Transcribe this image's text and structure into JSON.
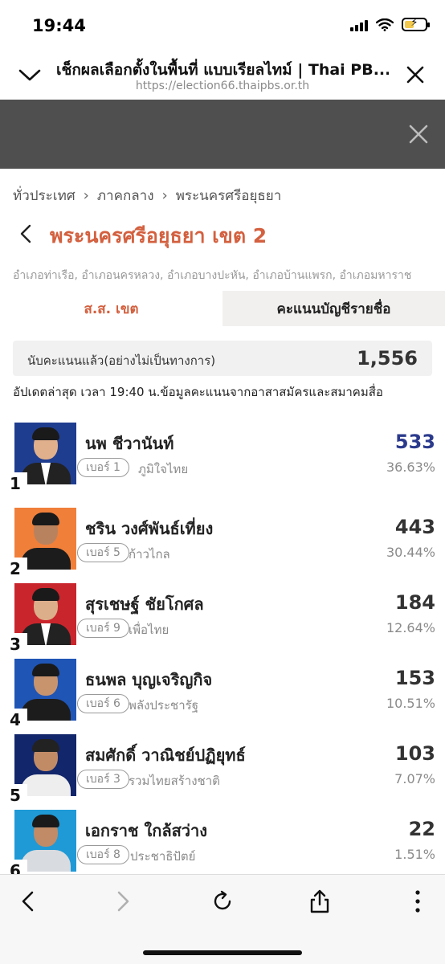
{
  "status": {
    "time": "19:44"
  },
  "browser": {
    "title": "เช็กผลเลือกตั้งในพื้นที่ แบบเรียลไทม์ | Thai PB...",
    "url": "https://election66.thaipbs.or.th"
  },
  "breadcrumb": [
    "ทั่วประเทศ",
    "ภาคกลาง",
    "พระนครศรีอยุธยา"
  ],
  "district": {
    "title": "พระนครศรีอยุธยา เขต 2",
    "subdistricts": "อำเภอท่าเรือ, อำเภอนครหลวง, อำเภอบางปะหัน, อำเภอบ้านแพรก, อำเภอมหาราช"
  },
  "tabs": [
    {
      "label": "ส.ส. เขต",
      "active": true
    },
    {
      "label": "คะแนนบัญชีรายชื่อ",
      "active": false
    }
  ],
  "count": {
    "label": "นับคะแนนแล้ว(อย่างไม่เป็นทางการ)",
    "value": "1,556"
  },
  "updated_note": "อัปเดตล่าสุด เวลา 19:40 น.ข้อมูลคะแนนจากอาสาสมัครและสมาคมสื่อ",
  "candidates": [
    {
      "rank": "1",
      "name": "นพ ชีวานันท์",
      "badge": "เบอร์ 1",
      "party": "ภูมิใจไทย",
      "votes": "533",
      "pct": "36.63%",
      "photo_bg": "#1f3d8f",
      "body": "#222",
      "skin": "#e0b08c",
      "hair": "#1a1a1a",
      "shirt": "#ffffff"
    },
    {
      "rank": "2",
      "name": "ชริน วงศ์พันธ์เที่ยง",
      "badge": "เบอร์ 5",
      "party": "ก้าวไกล",
      "votes": "443",
      "pct": "30.44%",
      "photo_bg": "#f07f3a",
      "body": "#1c1c1c",
      "skin": "#b9825e",
      "hair": "#1a1a1a",
      "shirt": "#1c1c1c"
    },
    {
      "rank": "3",
      "name": "สุรเชษฐ์ ชัยโกศล",
      "badge": "เบอร์ 9",
      "party": "เพื่อไทย",
      "votes": "184",
      "pct": "12.64%",
      "photo_bg": "#c9252c",
      "body": "#222",
      "skin": "#dcae8a",
      "hair": "#1a1a1a",
      "shirt": "#ffffff"
    },
    {
      "rank": "4",
      "name": "ธนพล บุญเจริญกิจ",
      "badge": "เบอร์ 6",
      "party": "พลังประชารัฐ",
      "votes": "153",
      "pct": "10.51%",
      "photo_bg": "#1f55b5",
      "body": "#1c1c1c",
      "skin": "#c8946e",
      "hair": "#1a1a1a",
      "shirt": "#1c1c1c"
    },
    {
      "rank": "5",
      "name": "สมศักดิ์ วาณิชย์ปฏิยุทธ์",
      "badge": "เบอร์ 3",
      "party": "รวมไทยสร้างชาติ",
      "votes": "103",
      "pct": "7.07%",
      "photo_bg": "#12266b",
      "body": "#eeeeee",
      "skin": "#c18b66",
      "hair": "#222222",
      "shirt": "#eeeeee"
    },
    {
      "rank": "6",
      "name": "เอกราช ใกล้สว่าง",
      "badge": "เบอร์ 8",
      "party": "ประชาธิปัตย์",
      "votes": "22",
      "pct": "1.51%",
      "photo_bg": "#1f9ad6",
      "body": "#d8dbe0",
      "skin": "#c08b66",
      "hair": "#1a1a1a",
      "shirt": "#d8dbe0"
    }
  ],
  "colors": {
    "accent": "#d3603f",
    "leader_votes": "#2b3a8c"
  },
  "toolbar": [
    "back-icon",
    "forward-icon",
    "reload-icon",
    "share-icon",
    "more-icon"
  ]
}
